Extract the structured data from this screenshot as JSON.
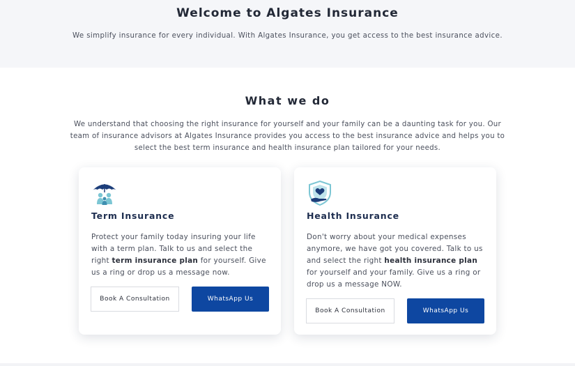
{
  "hero": {
    "title": "Welcome to Algates Insurance",
    "subtitle": "We simplify insurance for every individual. With Algates Insurance, you get access to the best insurance advice."
  },
  "section": {
    "title": "What we do",
    "intro": "We understand that choosing the right insurance for yourself and your family can be a daunting task for you. Our team of insurance advisors at Algates Insurance provides you access to the best insurance advice and helps you to select the best term insurance and health insurance plan tailored for your needs."
  },
  "cards": [
    {
      "icon": "umbrella-family-icon",
      "title": "Term Insurance",
      "desc_before": "Protect your family today insuring your life with a term plan. Talk to us and select the right ",
      "desc_bold": "term insurance plan",
      "desc_after": " for yourself. Give us a ring or drop us a message now.",
      "book_label": "Book A Consultation",
      "whatsapp_label": "WhatsApp Us"
    },
    {
      "icon": "shield-heart-hand-icon",
      "title": "Health Insurance",
      "desc_before": "Don't worry about your medical expenses anymore, we have got you covered. Talk to us and select the right ",
      "desc_bold": "health insurance plan",
      "desc_after": " for yourself and your family. Give us a ring or drop us a message NOW.",
      "book_label": "Book A Consultation",
      "whatsapp_label": "WhatsApp Us"
    }
  ],
  "colors": {
    "primary": "#0e47a1",
    "hero_bg": "#f5f6f9",
    "icon_teal": "#7cc6d4"
  }
}
